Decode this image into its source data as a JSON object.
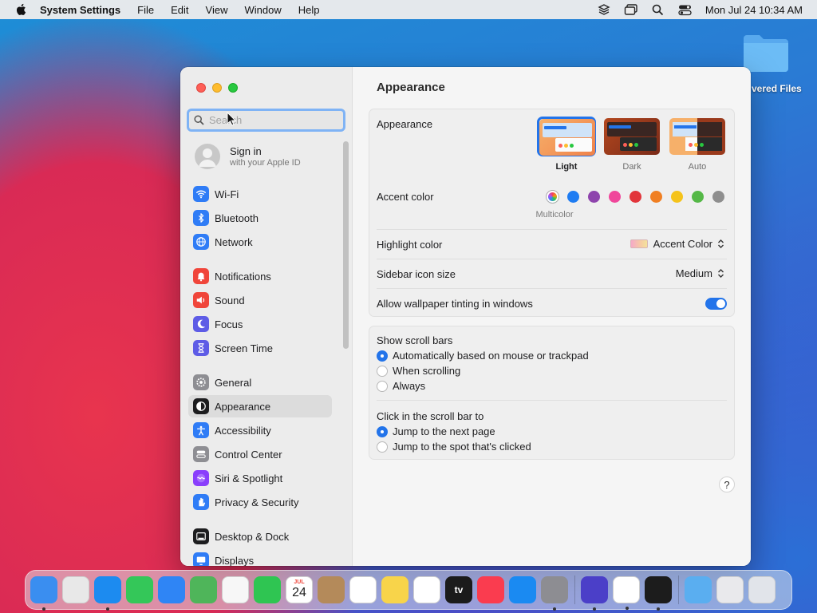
{
  "menubar": {
    "app_name": "System Settings",
    "menus": [
      "File",
      "Edit",
      "View",
      "Window",
      "Help"
    ],
    "clock": "Mon Jul 24  10:34 AM",
    "status_icons": [
      "layers-icon",
      "window-icon",
      "search-icon",
      "control-center-icon"
    ]
  },
  "desktop": {
    "folder_label": "vered Files"
  },
  "window": {
    "search": {
      "placeholder": "Search",
      "value": ""
    },
    "account": {
      "title": "Sign in",
      "subtitle": "with your Apple ID"
    },
    "sidebar": [
      {
        "label": "Wi-Fi",
        "icon": "wifi-icon",
        "color": "#2f7cf6"
      },
      {
        "label": "Bluetooth",
        "icon": "bluetooth-icon",
        "color": "#2f7cf6"
      },
      {
        "label": "Network",
        "icon": "globe-icon",
        "color": "#2f7cf6"
      },
      {
        "label": "Notifications",
        "icon": "bell-icon",
        "color": "#f0453a"
      },
      {
        "label": "Sound",
        "icon": "speaker-icon",
        "color": "#f0453a"
      },
      {
        "label": "Focus",
        "icon": "moon-icon",
        "color": "#5e5ce6"
      },
      {
        "label": "Screen Time",
        "icon": "hourglass-icon",
        "color": "#5e5ce6"
      },
      {
        "label": "General",
        "icon": "gear-icon",
        "color": "#8e8e93"
      },
      {
        "label": "Appearance",
        "icon": "appearance-icon",
        "color": "#1d1d1f",
        "selected": true
      },
      {
        "label": "Accessibility",
        "icon": "accessibility-icon",
        "color": "#2f7cf6"
      },
      {
        "label": "Control Center",
        "icon": "control-center-icon",
        "color": "#8e8e93"
      },
      {
        "label": "Siri & Spotlight",
        "icon": "siri-icon",
        "color": "#8a3ffc"
      },
      {
        "label": "Privacy & Security",
        "icon": "hand-icon",
        "color": "#2f7cf6"
      },
      {
        "label": "Desktop & Dock",
        "icon": "dock-icon",
        "color": "#1d1d1f"
      },
      {
        "label": "Displays",
        "icon": "display-icon",
        "color": "#2f7cf6"
      }
    ],
    "content": {
      "title": "Appearance",
      "appearance": {
        "label": "Appearance",
        "options": [
          {
            "label": "Light",
            "selected": true
          },
          {
            "label": "Dark",
            "selected": false
          },
          {
            "label": "Auto",
            "selected": false
          }
        ]
      },
      "accent": {
        "label": "Accent color",
        "selected_name": "Multicolor",
        "colors": [
          "#a855f7",
          "#1e7cf2",
          "#8e44ad",
          "#f0479b",
          "#e2353b",
          "#f07f22",
          "#f5c31b",
          "#55b847",
          "#8e8e8e"
        ]
      },
      "highlight": {
        "label": "Highlight color",
        "value": "Accent Color"
      },
      "sidebar_icon": {
        "label": "Sidebar icon size",
        "value": "Medium"
      },
      "tinting": {
        "label": "Allow wallpaper tinting in windows",
        "on": true
      },
      "scroll_bars": {
        "label": "Show scroll bars",
        "options": [
          {
            "label": "Automatically based on mouse or trackpad",
            "selected": true
          },
          {
            "label": "When scrolling",
            "selected": false
          },
          {
            "label": "Always",
            "selected": false
          }
        ]
      },
      "click_scroll": {
        "label": "Click in the scroll bar to",
        "options": [
          {
            "label": "Jump to the next page",
            "selected": true
          },
          {
            "label": "Jump to the spot that's clicked",
            "selected": false
          }
        ]
      },
      "help": "?"
    }
  },
  "dock": {
    "calendar": {
      "month": "JUL",
      "day": "24"
    },
    "apps": [
      {
        "name": "finder-icon",
        "color": "#3a8ef0"
      },
      {
        "name": "launchpad-icon",
        "color": "#e8e8e8"
      },
      {
        "name": "safari-icon",
        "color": "#1c8bf0"
      },
      {
        "name": "messages-icon",
        "color": "#34c759"
      },
      {
        "name": "mail-icon",
        "color": "#2f85f5"
      },
      {
        "name": "maps-icon",
        "color": "#4fb55a"
      },
      {
        "name": "photos-icon",
        "color": "#f7f7f7"
      },
      {
        "name": "facetime-icon",
        "color": "#2fc552"
      },
      {
        "name": "calendar-icon",
        "color": "#ffffff"
      },
      {
        "name": "contacts-icon",
        "color": "#b48a5a"
      },
      {
        "name": "reminders-icon",
        "color": "#ffffff"
      },
      {
        "name": "notes-icon",
        "color": "#f8d44a"
      },
      {
        "name": "freeform-icon",
        "color": "#ffffff"
      },
      {
        "name": "tv-icon",
        "color": "#1b1b1b"
      },
      {
        "name": "music-icon",
        "color": "#fa3c4f"
      },
      {
        "name": "app-store-icon",
        "color": "#1a8af2"
      },
      {
        "name": "system-settings-icon",
        "color": "#8d8d92"
      },
      {
        "name": "shortcuts-icon",
        "color": "#4b3fc8"
      },
      {
        "name": "news-icon",
        "color": "#ffffff"
      },
      {
        "name": "terminal-icon",
        "color": "#1c1c1c"
      },
      {
        "name": "downloads-folder-icon",
        "color": "#5aaef0"
      },
      {
        "name": "recent-files-icon",
        "color": "#e9e9ec"
      },
      {
        "name": "trash-icon",
        "color": "#e1e4ea"
      }
    ],
    "tv_label": "tv"
  }
}
